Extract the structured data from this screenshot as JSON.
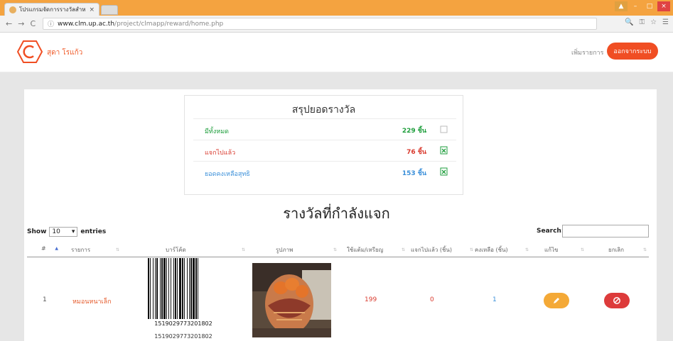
{
  "browser": {
    "tab_title": "โปรแกรมจัดการรางวัลสำหรั",
    "tab_close": "×",
    "url_host": "www.clm.up.ac.th",
    "url_path": "/project/clmapp/reward/home.php",
    "nav_back": "←",
    "nav_forward": "→",
    "nav_reload": "C",
    "info_icon": "ⓘ",
    "tools": [
      "🔍",
      "⚿",
      "☆",
      "☰"
    ]
  },
  "header": {
    "user_name": "สุดา โรแก้ว",
    "add_item_label": "เพิ่มรายการ",
    "logout_label": "ออกจากระบบ"
  },
  "summary": {
    "title": "สรุปยอดรางวัล",
    "rows": [
      {
        "label": "มีทั้งหมด",
        "count": "229 ชิ้น"
      },
      {
        "label": "แจกไปแล้ว",
        "count": "76 ชิ้น"
      },
      {
        "label": "ยอดคงเหลือสุทธิ",
        "count": "153 ชิ้น"
      }
    ],
    "colors": {
      "total": "#1e9e3c",
      "given": "#d93a2e",
      "remaining": "#3a8fd9"
    }
  },
  "section_title": "รางวัลที่กำลังแจก",
  "table": {
    "show_label": "Show",
    "entries_value": "10",
    "entries_label": "entries",
    "search_label": "Search:",
    "search_value": "",
    "columns": [
      "#",
      "รายการ",
      "บาร์โค้ด",
      "รูปภาพ",
      "ใช้แต้ม/เหรียญ",
      "แจกไปแล้ว (ชิ้น)",
      "คงเหลือ (ชิ้น)",
      "แก้ไข",
      "ยกเลิก"
    ],
    "rows": [
      {
        "index": "1",
        "item": "หมอนหนาเล็ก",
        "barcode": "1519029773201802",
        "barcode_caption": "1519029773201802",
        "points": "199",
        "given": "0",
        "remaining": "1",
        "edit_icon": "pencil-icon",
        "cancel_icon": "ban-icon"
      }
    ]
  },
  "colors": {
    "accent": "#f04e23",
    "edit": "#f4a937",
    "cancel": "#dd3b3b"
  }
}
